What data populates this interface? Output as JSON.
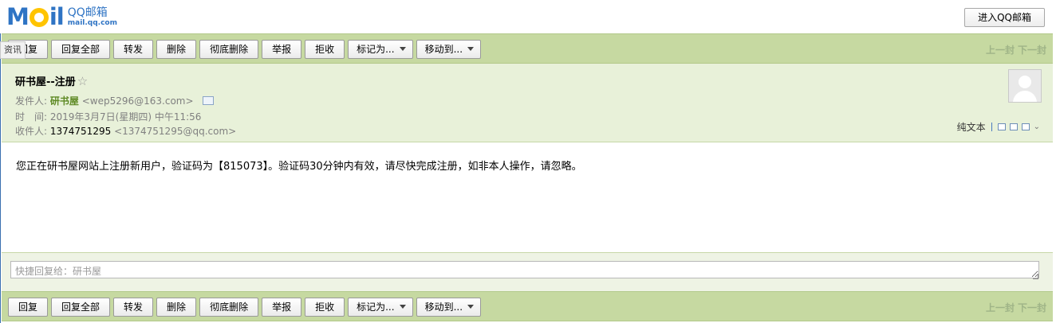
{
  "logo": {
    "text_m": "M",
    "text_il": "il",
    "name_cn": "QQ邮箱",
    "url": "mail.qq.com"
  },
  "topbar": {
    "enter_button": "进入QQ邮箱"
  },
  "side_tag": "资讯",
  "toolbar": {
    "reply": "回复",
    "reply_all": "回复全部",
    "forward": "转发",
    "delete": "删除",
    "delete_permanently": "彻底删除",
    "report": "举报",
    "reject": "拒收",
    "mark_as": "标记为...",
    "move_to": "移动到...",
    "prev": "上一封",
    "next": "下一封"
  },
  "mail": {
    "subject": "研书屋--注册",
    "star": "☆",
    "from_label": "发件人:",
    "from_name": "研书屋",
    "from_addr": "<wep5296@163.com>",
    "time_label": "时　间:",
    "time": "2019年3月7日(星期四) 中午11:56",
    "to_label": "收件人:",
    "to_name": "1374751295",
    "to_addr": "<1374751295@qq.com>",
    "plain_text": "纯文本",
    "body": "您正在研书屋网站上注册新用户，验证码为【815073】。验证码30分钟内有效，请尽快完成注册，如非本人操作，请忽略。"
  },
  "quick_reply": {
    "placeholder": "快捷回复给：研书屋"
  },
  "colors": {
    "toolbar_bg": "#c6d9a1",
    "header_bg": "#e8f1d9",
    "sender_green": "#5f8a25",
    "logo_blue": "#2f74c4",
    "logo_yellow": "#ffc400"
  }
}
